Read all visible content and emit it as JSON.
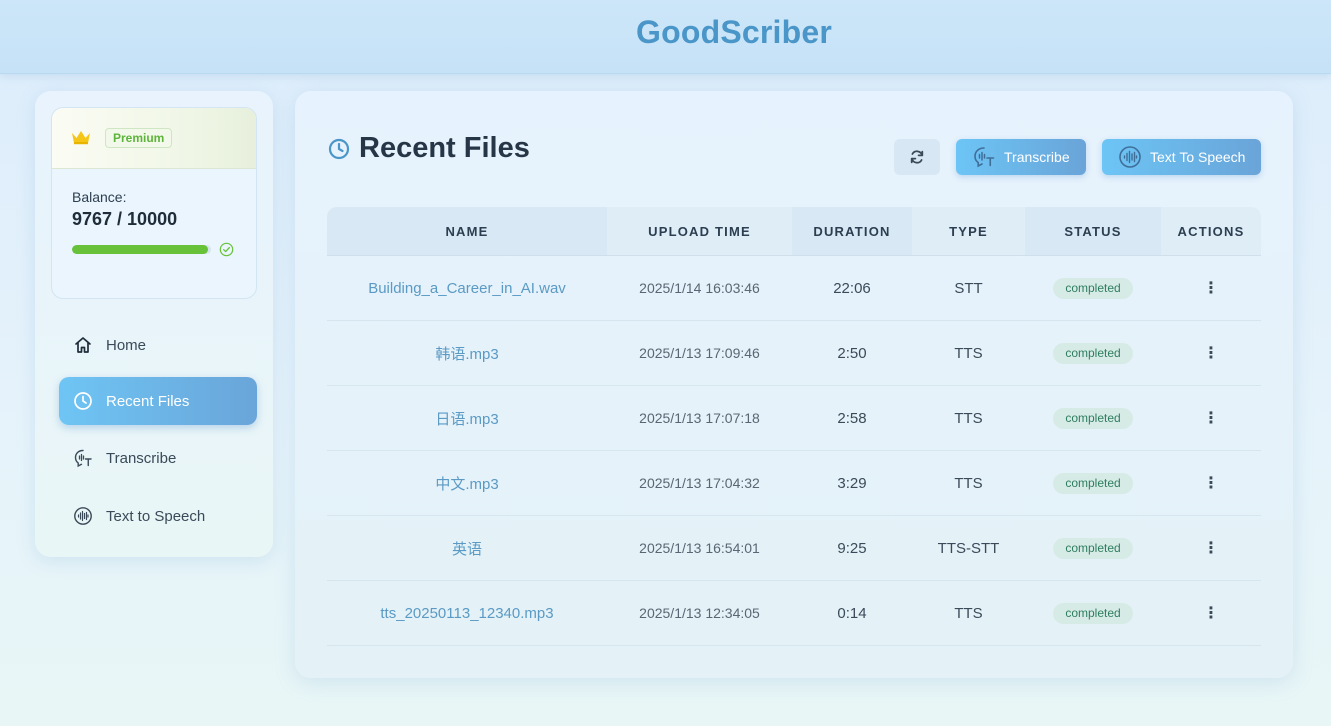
{
  "app": {
    "brand": "GoodScriber"
  },
  "colors": {
    "accent": "#4a96c8",
    "success": "#67c23a",
    "premium": "#5db43a"
  },
  "account": {
    "plan": "Premium",
    "balance_label": "Balance:",
    "balance_value": "9767 / 10000",
    "balance_fraction": 0.9767
  },
  "sidebar": {
    "items": [
      {
        "label": "Home",
        "icon": "home-icon"
      },
      {
        "label": "Recent Files",
        "icon": "clock-icon",
        "active": true
      },
      {
        "label": "Transcribe",
        "icon": "transcribe-icon"
      },
      {
        "label": "Text to Speech",
        "icon": "soundwave-icon"
      }
    ]
  },
  "main": {
    "title": "Recent Files",
    "buttons": {
      "refresh_icon": "refresh-icon",
      "transcribe": "Transcribe",
      "tts": "Text To Speech"
    },
    "table": {
      "headers": [
        "NAME",
        "UPLOAD TIME",
        "DURATION",
        "TYPE",
        "STATUS",
        "ACTIONS"
      ],
      "rows": [
        {
          "name": "Building_a_Career_in_AI.wav",
          "time": "2025/1/14 16:03:46",
          "duration": "22:06",
          "type": "STT",
          "status": "completed"
        },
        {
          "name": "韩语.mp3",
          "time": "2025/1/13 17:09:46",
          "duration": "2:50",
          "type": "TTS",
          "status": "completed"
        },
        {
          "name": "日语.mp3",
          "time": "2025/1/13 17:07:18",
          "duration": "2:58",
          "type": "TTS",
          "status": "completed"
        },
        {
          "name": "中文.mp3",
          "time": "2025/1/13 17:04:32",
          "duration": "3:29",
          "type": "TTS",
          "status": "completed"
        },
        {
          "name": "英语",
          "time": "2025/1/13 16:54:01",
          "duration": "9:25",
          "type": "TTS-STT",
          "status": "completed"
        },
        {
          "name": "tts_20250113_12340.mp3",
          "time": "2025/1/13 12:34:05",
          "duration": "0:14",
          "type": "TTS",
          "status": "completed"
        }
      ]
    }
  }
}
